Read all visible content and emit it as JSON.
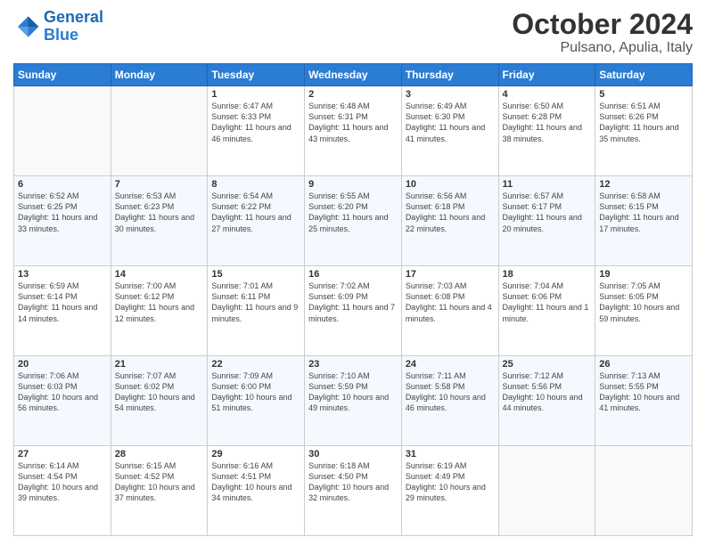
{
  "header": {
    "logo": {
      "line1": "General",
      "line2": "Blue"
    },
    "month": "October 2024",
    "location": "Pulsano, Apulia, Italy"
  },
  "columns": [
    "Sunday",
    "Monday",
    "Tuesday",
    "Wednesday",
    "Thursday",
    "Friday",
    "Saturday"
  ],
  "weeks": [
    [
      {
        "day": "",
        "sunrise": "",
        "sunset": "",
        "daylight": ""
      },
      {
        "day": "",
        "sunrise": "",
        "sunset": "",
        "daylight": ""
      },
      {
        "day": "1",
        "sunrise": "Sunrise: 6:47 AM",
        "sunset": "Sunset: 6:33 PM",
        "daylight": "Daylight: 11 hours and 46 minutes."
      },
      {
        "day": "2",
        "sunrise": "Sunrise: 6:48 AM",
        "sunset": "Sunset: 6:31 PM",
        "daylight": "Daylight: 11 hours and 43 minutes."
      },
      {
        "day": "3",
        "sunrise": "Sunrise: 6:49 AM",
        "sunset": "Sunset: 6:30 PM",
        "daylight": "Daylight: 11 hours and 41 minutes."
      },
      {
        "day": "4",
        "sunrise": "Sunrise: 6:50 AM",
        "sunset": "Sunset: 6:28 PM",
        "daylight": "Daylight: 11 hours and 38 minutes."
      },
      {
        "day": "5",
        "sunrise": "Sunrise: 6:51 AM",
        "sunset": "Sunset: 6:26 PM",
        "daylight": "Daylight: 11 hours and 35 minutes."
      }
    ],
    [
      {
        "day": "6",
        "sunrise": "Sunrise: 6:52 AM",
        "sunset": "Sunset: 6:25 PM",
        "daylight": "Daylight: 11 hours and 33 minutes."
      },
      {
        "day": "7",
        "sunrise": "Sunrise: 6:53 AM",
        "sunset": "Sunset: 6:23 PM",
        "daylight": "Daylight: 11 hours and 30 minutes."
      },
      {
        "day": "8",
        "sunrise": "Sunrise: 6:54 AM",
        "sunset": "Sunset: 6:22 PM",
        "daylight": "Daylight: 11 hours and 27 minutes."
      },
      {
        "day": "9",
        "sunrise": "Sunrise: 6:55 AM",
        "sunset": "Sunset: 6:20 PM",
        "daylight": "Daylight: 11 hours and 25 minutes."
      },
      {
        "day": "10",
        "sunrise": "Sunrise: 6:56 AM",
        "sunset": "Sunset: 6:18 PM",
        "daylight": "Daylight: 11 hours and 22 minutes."
      },
      {
        "day": "11",
        "sunrise": "Sunrise: 6:57 AM",
        "sunset": "Sunset: 6:17 PM",
        "daylight": "Daylight: 11 hours and 20 minutes."
      },
      {
        "day": "12",
        "sunrise": "Sunrise: 6:58 AM",
        "sunset": "Sunset: 6:15 PM",
        "daylight": "Daylight: 11 hours and 17 minutes."
      }
    ],
    [
      {
        "day": "13",
        "sunrise": "Sunrise: 6:59 AM",
        "sunset": "Sunset: 6:14 PM",
        "daylight": "Daylight: 11 hours and 14 minutes."
      },
      {
        "day": "14",
        "sunrise": "Sunrise: 7:00 AM",
        "sunset": "Sunset: 6:12 PM",
        "daylight": "Daylight: 11 hours and 12 minutes."
      },
      {
        "day": "15",
        "sunrise": "Sunrise: 7:01 AM",
        "sunset": "Sunset: 6:11 PM",
        "daylight": "Daylight: 11 hours and 9 minutes."
      },
      {
        "day": "16",
        "sunrise": "Sunrise: 7:02 AM",
        "sunset": "Sunset: 6:09 PM",
        "daylight": "Daylight: 11 hours and 7 minutes."
      },
      {
        "day": "17",
        "sunrise": "Sunrise: 7:03 AM",
        "sunset": "Sunset: 6:08 PM",
        "daylight": "Daylight: 11 hours and 4 minutes."
      },
      {
        "day": "18",
        "sunrise": "Sunrise: 7:04 AM",
        "sunset": "Sunset: 6:06 PM",
        "daylight": "Daylight: 11 hours and 1 minute."
      },
      {
        "day": "19",
        "sunrise": "Sunrise: 7:05 AM",
        "sunset": "Sunset: 6:05 PM",
        "daylight": "Daylight: 10 hours and 59 minutes."
      }
    ],
    [
      {
        "day": "20",
        "sunrise": "Sunrise: 7:06 AM",
        "sunset": "Sunset: 6:03 PM",
        "daylight": "Daylight: 10 hours and 56 minutes."
      },
      {
        "day": "21",
        "sunrise": "Sunrise: 7:07 AM",
        "sunset": "Sunset: 6:02 PM",
        "daylight": "Daylight: 10 hours and 54 minutes."
      },
      {
        "day": "22",
        "sunrise": "Sunrise: 7:09 AM",
        "sunset": "Sunset: 6:00 PM",
        "daylight": "Daylight: 10 hours and 51 minutes."
      },
      {
        "day": "23",
        "sunrise": "Sunrise: 7:10 AM",
        "sunset": "Sunset: 5:59 PM",
        "daylight": "Daylight: 10 hours and 49 minutes."
      },
      {
        "day": "24",
        "sunrise": "Sunrise: 7:11 AM",
        "sunset": "Sunset: 5:58 PM",
        "daylight": "Daylight: 10 hours and 46 minutes."
      },
      {
        "day": "25",
        "sunrise": "Sunrise: 7:12 AM",
        "sunset": "Sunset: 5:56 PM",
        "daylight": "Daylight: 10 hours and 44 minutes."
      },
      {
        "day": "26",
        "sunrise": "Sunrise: 7:13 AM",
        "sunset": "Sunset: 5:55 PM",
        "daylight": "Daylight: 10 hours and 41 minutes."
      }
    ],
    [
      {
        "day": "27",
        "sunrise": "Sunrise: 6:14 AM",
        "sunset": "Sunset: 4:54 PM",
        "daylight": "Daylight: 10 hours and 39 minutes."
      },
      {
        "day": "28",
        "sunrise": "Sunrise: 6:15 AM",
        "sunset": "Sunset: 4:52 PM",
        "daylight": "Daylight: 10 hours and 37 minutes."
      },
      {
        "day": "29",
        "sunrise": "Sunrise: 6:16 AM",
        "sunset": "Sunset: 4:51 PM",
        "daylight": "Daylight: 10 hours and 34 minutes."
      },
      {
        "day": "30",
        "sunrise": "Sunrise: 6:18 AM",
        "sunset": "Sunset: 4:50 PM",
        "daylight": "Daylight: 10 hours and 32 minutes."
      },
      {
        "day": "31",
        "sunrise": "Sunrise: 6:19 AM",
        "sunset": "Sunset: 4:49 PM",
        "daylight": "Daylight: 10 hours and 29 minutes."
      },
      {
        "day": "",
        "sunrise": "",
        "sunset": "",
        "daylight": ""
      },
      {
        "day": "",
        "sunrise": "",
        "sunset": "",
        "daylight": ""
      }
    ]
  ]
}
